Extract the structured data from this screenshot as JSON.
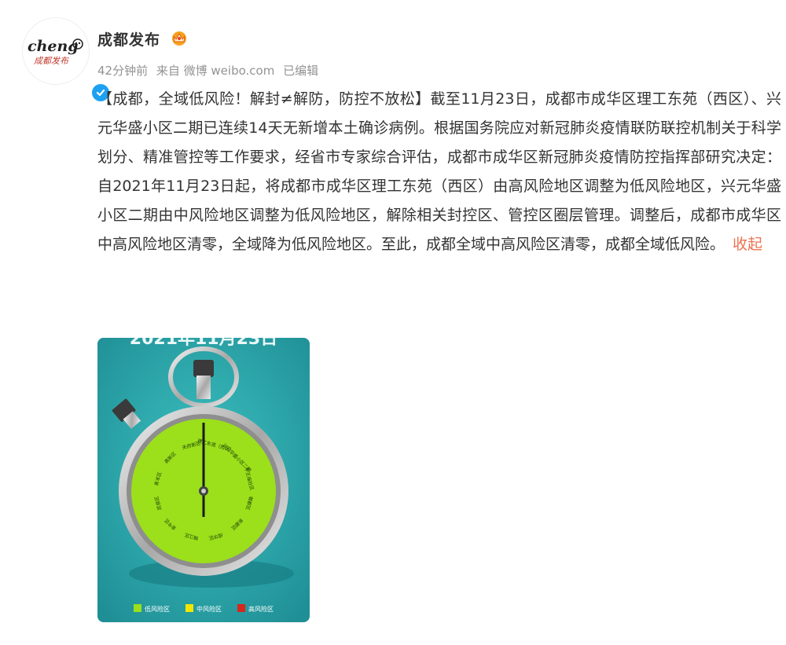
{
  "account": {
    "name": "成都发布",
    "avatar_logo_text": "cheng",
    "avatar_sub_text": "成都发布",
    "badge_icon": "crown-icon",
    "verified_icon": "verified-check-icon"
  },
  "meta": {
    "time": "42分钟前",
    "source": "来自 微博 weibo.com",
    "edited": "已编辑"
  },
  "post": {
    "text": "【成都，全域低风险！解封≠解防，防控不放松】截至11月23日，成都市成华区理工东苑（西区）、兴元华盛小区二期已连续14天无新增本土确诊病例。根据国务院应对新冠肺炎疫情联防联控机制关于科学划分、精准管控等工作要求，经省市专家综合评估，成都市成华区新冠肺炎疫情防控指挥部研究决定：自2021年11月23日起，将成都市成华区理工东苑（西区）由高风险地区调整为低风险地区，兴元华盛小区二期由中风险地区调整为低风险地区，解除相关封控区、管控区圈层管理。调整后，成都市成华区中高风险地区清零，全域降为低风险地区。至此，成都全域中高风险区清零，成都全域低风险。",
    "collapse_label": "收起"
  },
  "image": {
    "header_text": "2021年11月23日",
    "dial_labels": [
      "理工东苑（西区）",
      "兴元华盛小区二期",
      "牛王庙社区",
      "郫都区",
      "新都区",
      "成华区",
      "锦江区",
      "金牛区",
      "武侯区",
      "青羊区",
      "高新区",
      "天府新区"
    ],
    "legend": [
      {
        "label": "低风险区",
        "color": "#9be01a"
      },
      {
        "label": "中风险区",
        "color": "#f2e600"
      },
      {
        "label": "高风险区",
        "color": "#d9261c"
      }
    ]
  }
}
